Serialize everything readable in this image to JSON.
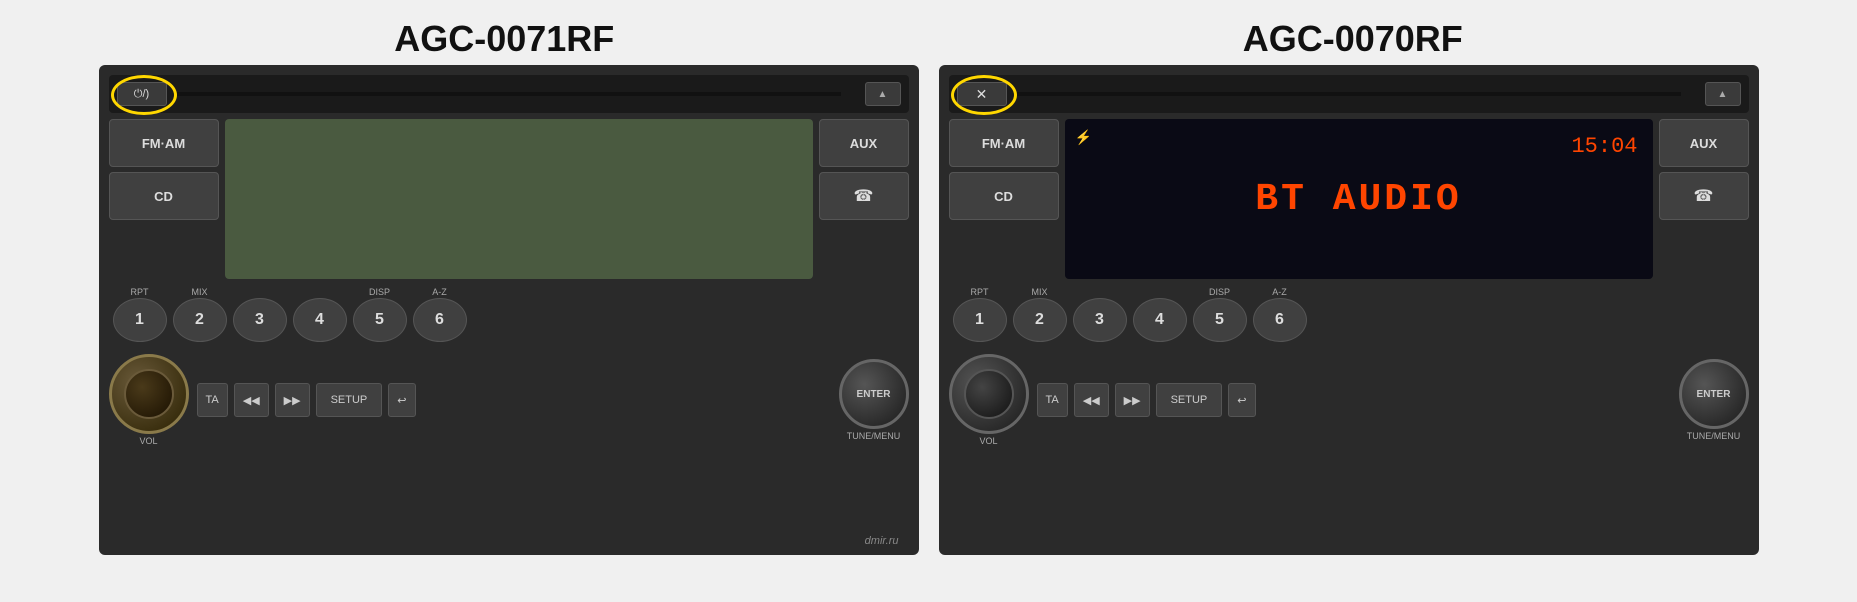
{
  "page": {
    "background": "#f0f0f0"
  },
  "left_unit": {
    "title": "AGC-0071RF",
    "top_btn_label": "⏻/)",
    "circle_label": "power-bt-circle-left",
    "fm_am_label": "FM·AM",
    "cd_label": "CD",
    "aux_label": "AUX",
    "phone_symbol": "☎",
    "rpt_label": "RPT",
    "mix_label": "MIX",
    "disp_label": "DISP",
    "az_label": "A-Z",
    "presets": [
      "1",
      "2",
      "3",
      "4",
      "5",
      "6"
    ],
    "ta_label": "TA",
    "prev_label": "◀◀",
    "next_label": "▶▶",
    "setup_label": "SETUP",
    "back_label": "↩",
    "vol_label": "VOL",
    "tune_menu_label": "TUNE/MENU",
    "enter_label": "ENTER",
    "eject_label": "▲"
  },
  "right_unit": {
    "title": "AGC-0070RF",
    "top_btn_label": "✕",
    "circle_label": "bt-circle-right",
    "fm_am_label": "FM·AM",
    "cd_label": "CD",
    "aux_label": "AUX",
    "phone_symbol": "☎",
    "display_time": "15:04",
    "display_text": "BT AUDIO",
    "bt_icon": "🔵",
    "rpt_label": "RPT",
    "mix_label": "MIX",
    "disp_label": "DISP",
    "az_label": "A-Z",
    "presets": [
      "1",
      "2",
      "3",
      "4",
      "5",
      "6"
    ],
    "ta_label": "TA",
    "prev_label": "◀◀",
    "next_label": "▶▶",
    "setup_label": "SETUP",
    "back_label": "↩",
    "vol_label": "VOL",
    "tune_menu_label": "TUNE/MENU",
    "enter_label": "ENTER",
    "eject_label": "▲"
  },
  "watermark": "dmir.ru"
}
